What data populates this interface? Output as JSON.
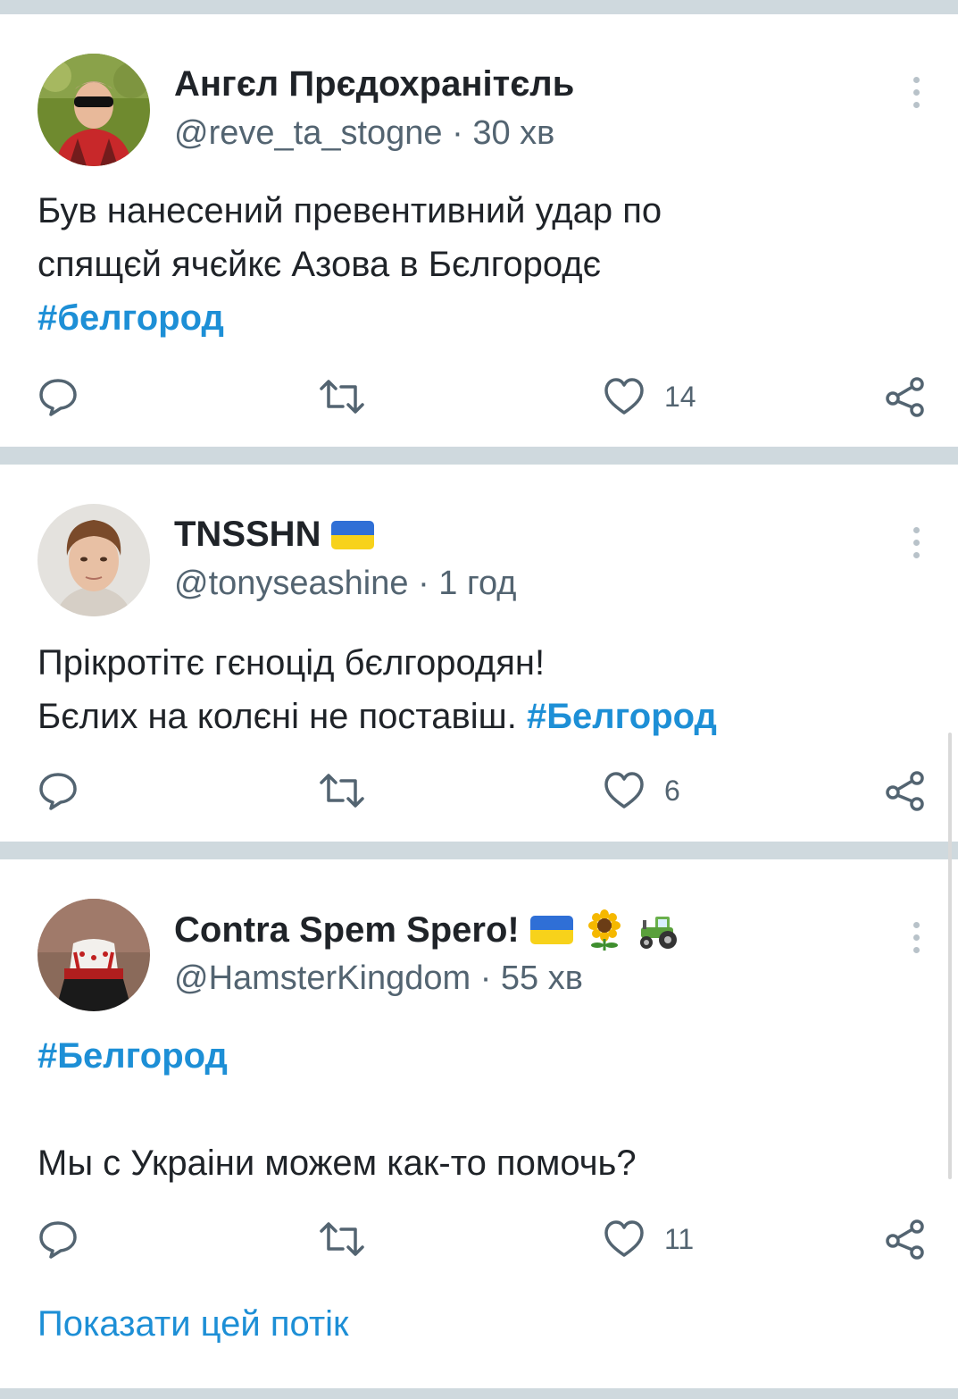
{
  "colors": {
    "accent": "#1d8fd6",
    "separator": "#cfd9de",
    "muted": "#536471"
  },
  "tweets": [
    {
      "name": "Ангєл Прєдохранітєль",
      "name_emoji": [],
      "handle": "@reve_ta_stogne",
      "time": "· 30 хв",
      "lines": [
        [
          {
            "t": "Був нанесений превентивний удар по",
            "tag": false
          }
        ],
        [
          {
            "t": "спящєй ячєйкє Азова в Бєлгородє",
            "tag": false
          }
        ],
        [
          {
            "t": "#белгород",
            "tag": true
          }
        ]
      ],
      "likes": "14",
      "avatar": "avatar-photo-boy"
    },
    {
      "name": "TNSSHN",
      "name_emoji": [
        "ukraine-flag"
      ],
      "handle": "@tonyseashine",
      "time": "· 1 год",
      "lines": [
        [
          {
            "t": "Прікротітє гєноцід бєлгородян!",
            "tag": false
          }
        ],
        [
          {
            "t": "Бєлих на колєні не поставіш. ",
            "tag": false
          },
          {
            "t": "#Белгород",
            "tag": true
          }
        ]
      ],
      "likes": "6",
      "avatar": "avatar-photo-man"
    },
    {
      "name": "Contra Spem Spero!",
      "name_emoji": [
        "ukraine-flag",
        "sunflower",
        "tractor"
      ],
      "handle": "@HamsterKingdom",
      "time": "· 55 хв",
      "lines": [
        [
          {
            "t": "#Белгород",
            "tag": true
          }
        ],
        [
          {
            "t": "",
            "tag": false
          }
        ],
        [
          {
            "t": "Мы с Украіни можем как-то помочь?",
            "tag": false
          }
        ]
      ],
      "likes": "11",
      "avatar": "avatar-photo-costume"
    }
  ],
  "show_thread": "Показати цей потік"
}
